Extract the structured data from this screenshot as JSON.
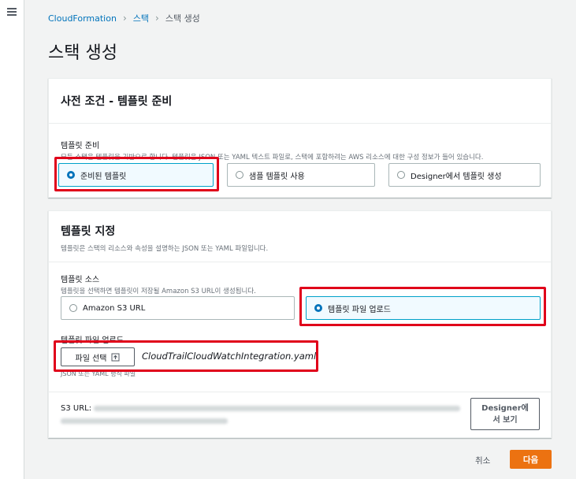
{
  "breadcrumb": {
    "root": "CloudFormation",
    "stacks": "스택",
    "current": "스택 생성"
  },
  "page": {
    "title": "스택 생성"
  },
  "prereq": {
    "title": "사전 조건 - 템플릿 준비",
    "field_label": "템플릿 준비",
    "field_desc": "모든 스택은 템플릿을 기반으로 합니다. 템플릿은 JSON 또는 YAML 텍스트 파일로, 스택에 포함하려는 AWS 리소스에 대한 구성 정보가 들어 있습니다.",
    "options": [
      {
        "label": "준비된 템플릿",
        "selected": true
      },
      {
        "label": "샘플 템플릿 사용",
        "selected": false
      },
      {
        "label": "Designer에서 템플릿 생성",
        "selected": false
      }
    ]
  },
  "spec": {
    "title": "템플릿 지정",
    "subtitle": "템플릿은 스택의 리소스와 속성을 설명하는 JSON 또는 YAML 파일입니다.",
    "source_label": "템플릿 소스",
    "source_desc": "템플릿을 선택하면 템플릿이 저장될 Amazon S3 URL이 생성됩니다.",
    "source_options": [
      {
        "label": "Amazon S3 URL",
        "selected": false
      },
      {
        "label": "템플릿 파일 업로드",
        "selected": true
      }
    ],
    "upload_label": "템플릿 파일 업로드",
    "choose_file": "파일 선택",
    "file_name": "CloudTrailCloudWatchIntegration.yaml",
    "upload_hint": "JSON 또는 YAML 형식 파일",
    "s3_url_label": "S3 URL:",
    "designer_button": "Designer에서 보기"
  },
  "footer": {
    "cancel": "취소",
    "next": "다음"
  },
  "colors": {
    "accent": "#0073bb",
    "primary_button": "#ec7211",
    "highlight": "#e0001a"
  }
}
